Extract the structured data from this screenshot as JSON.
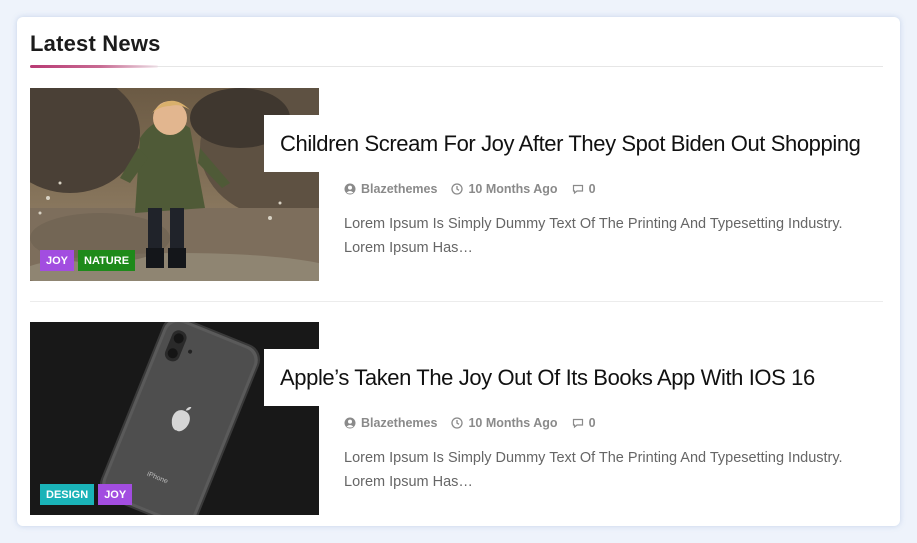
{
  "widget": {
    "title": "Latest News"
  },
  "articles": [
    {
      "title": "Children Scream For Joy After They Spot Biden Out Shopping",
      "categories": [
        {
          "label": "JOY",
          "color": "#a24de0"
        },
        {
          "label": "NATURE",
          "color": "#1e8a1a"
        }
      ],
      "author": "Blazethemes",
      "date": "10 Months Ago",
      "comments": "0",
      "excerpt_line1": "Lorem Ipsum Is Simply Dummy Text Of The Printing And Typesetting Industry.",
      "excerpt_line2": "Lorem Ipsum Has…",
      "image_desc": "child-jumping-in-puddle"
    },
    {
      "title": "Apple’s Taken The Joy Out Of Its Books App With IOS 16",
      "categories": [
        {
          "label": "DESIGN",
          "color": "#1ab3b8"
        },
        {
          "label": "JOY",
          "color": "#a24de0"
        }
      ],
      "author": "Blazethemes",
      "date": "10 Months Ago",
      "comments": "0",
      "excerpt_line1": "Lorem Ipsum Is Simply Dummy Text Of The Printing And Typesetting Industry.",
      "excerpt_line2": "Lorem Ipsum Has…",
      "image_desc": "iphone-on-dark-surface",
      "phone_label": "iPhone"
    }
  ],
  "icons": {
    "author": "user-circle-icon",
    "date": "clock-icon",
    "comments": "comment-icon"
  },
  "colors": {
    "accent": "#b83a74"
  }
}
